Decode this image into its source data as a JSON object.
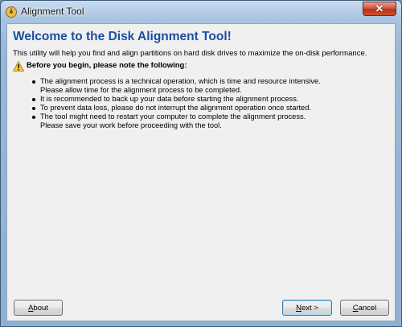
{
  "window": {
    "title": "Alignment Tool",
    "close_glyph": "✕"
  },
  "main": {
    "heading": "Welcome to the Disk Alignment Tool!",
    "intro": "This utility will help you find and align partitions on hard disk drives to maximize the on-disk performance.",
    "warning_icon": "warning-triangle-icon",
    "warning_text": "Before you begin, please note the following:",
    "bullets": [
      {
        "line1": "The alignment process is a technical operation, which is time and resource intensive.",
        "line2": "Please allow time for the alignment process to be completed."
      },
      {
        "line1": "It is recommended to back up your data before starting the alignment process."
      },
      {
        "line1": "To prevent data loss, please do not interrupt the alignment operation once started."
      },
      {
        "line1": "The tool might need to restart your computer to complete the alignment process.",
        "line2": "Please save your work before proceeding with the tool."
      }
    ]
  },
  "buttons": {
    "about": {
      "mnemonic": "A",
      "rest": "bout"
    },
    "next": {
      "mnemonic": "N",
      "rest": "ext >"
    },
    "cancel": {
      "mnemonic": "C",
      "rest": "ancel"
    }
  },
  "colors": {
    "heading": "#1a4fa0",
    "close_button": "#c94f2f",
    "client_background": "#f0f0f0"
  }
}
